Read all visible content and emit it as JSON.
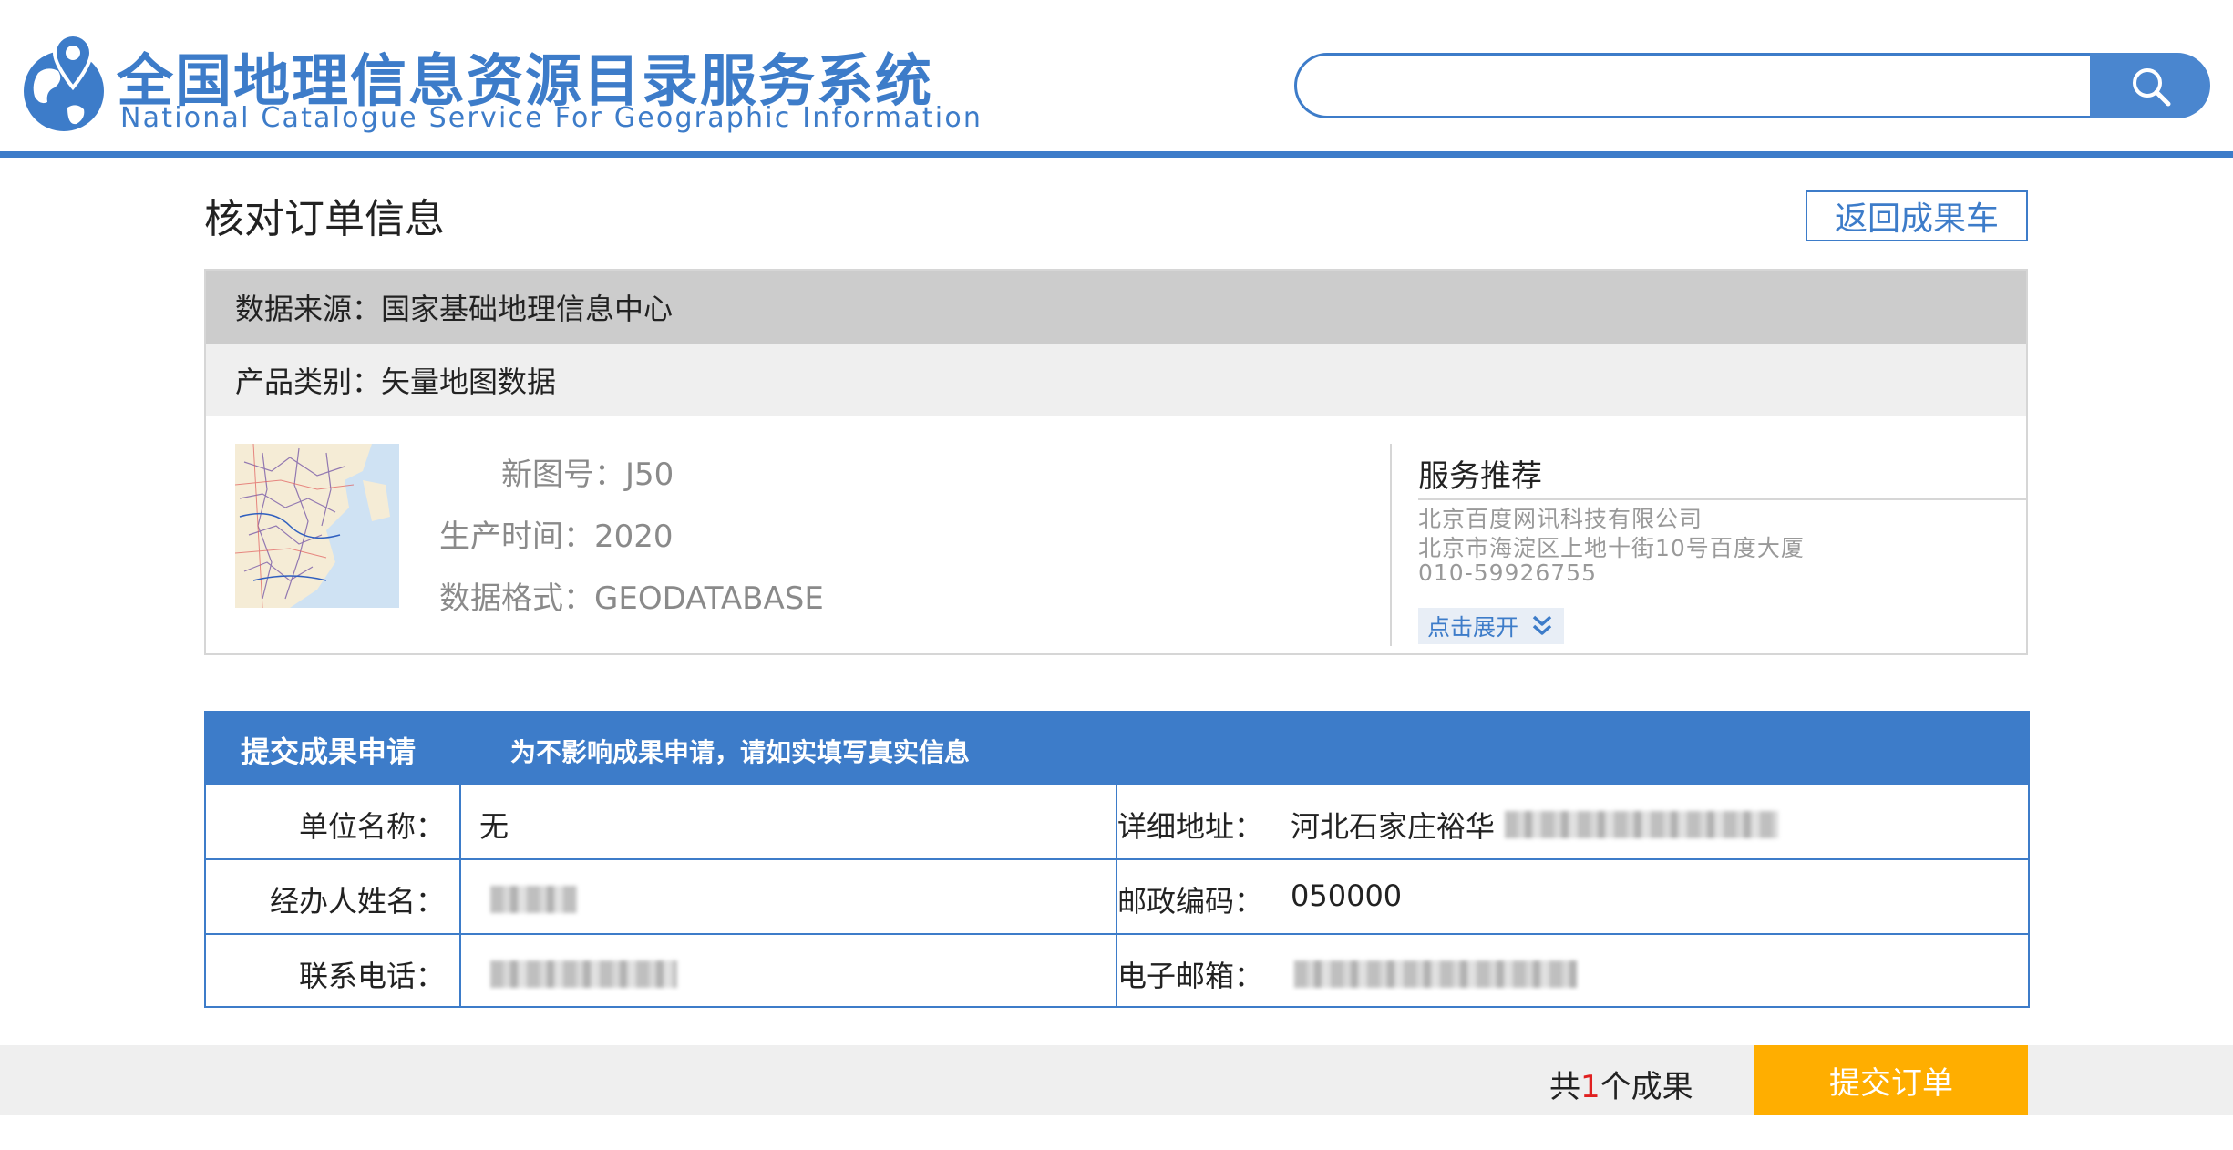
{
  "header": {
    "logo_cn": "全国地理信息资源目录服务系统",
    "logo_en": "National Catalogue Service For Geographic Information",
    "search": {
      "value": "",
      "placeholder": ""
    },
    "accent_color": "#3d7cc9"
  },
  "page": {
    "title": "核对订单信息",
    "back_label": "返回成果车"
  },
  "order": {
    "source_label": "数据来源：",
    "source_value": "国家基础地理信息中心",
    "category_label": "产品类别：",
    "category_value": "矢量地图数据",
    "fields": [
      {
        "label": "新图号：",
        "value": "J50"
      },
      {
        "label": "生产时间：",
        "value": "2020"
      },
      {
        "label": "数据格式：",
        "value": "GEODATABASE"
      }
    ],
    "thumbnail_icon": "map-thumbnail"
  },
  "service": {
    "title": "服务推荐",
    "company": "北京百度网讯科技有限公司",
    "address": "北京市海淀区上地十街10号百度大厦",
    "phone": "010-59926755",
    "expand_label": "点击展开"
  },
  "apply": {
    "title": "提交成果申请",
    "note": "为不影响成果申请，请如实填写真实信息",
    "org_label": "单位名称：",
    "org_value": "无",
    "address_label": "详细地址：",
    "address_value": "河北石家庄裕华",
    "handler_label": "经办人姓名：",
    "handler_value": "",
    "postcode_label": "邮政编码：",
    "postcode_value": "050000",
    "phone_label": "联系电话：",
    "phone_value": "",
    "email_label": "电子邮箱：",
    "email_value": ""
  },
  "footer": {
    "count_prefix": "共",
    "count": "1",
    "count_suffix": "个成果",
    "submit_label": "提交订单",
    "submit_color": "#ffae00"
  }
}
